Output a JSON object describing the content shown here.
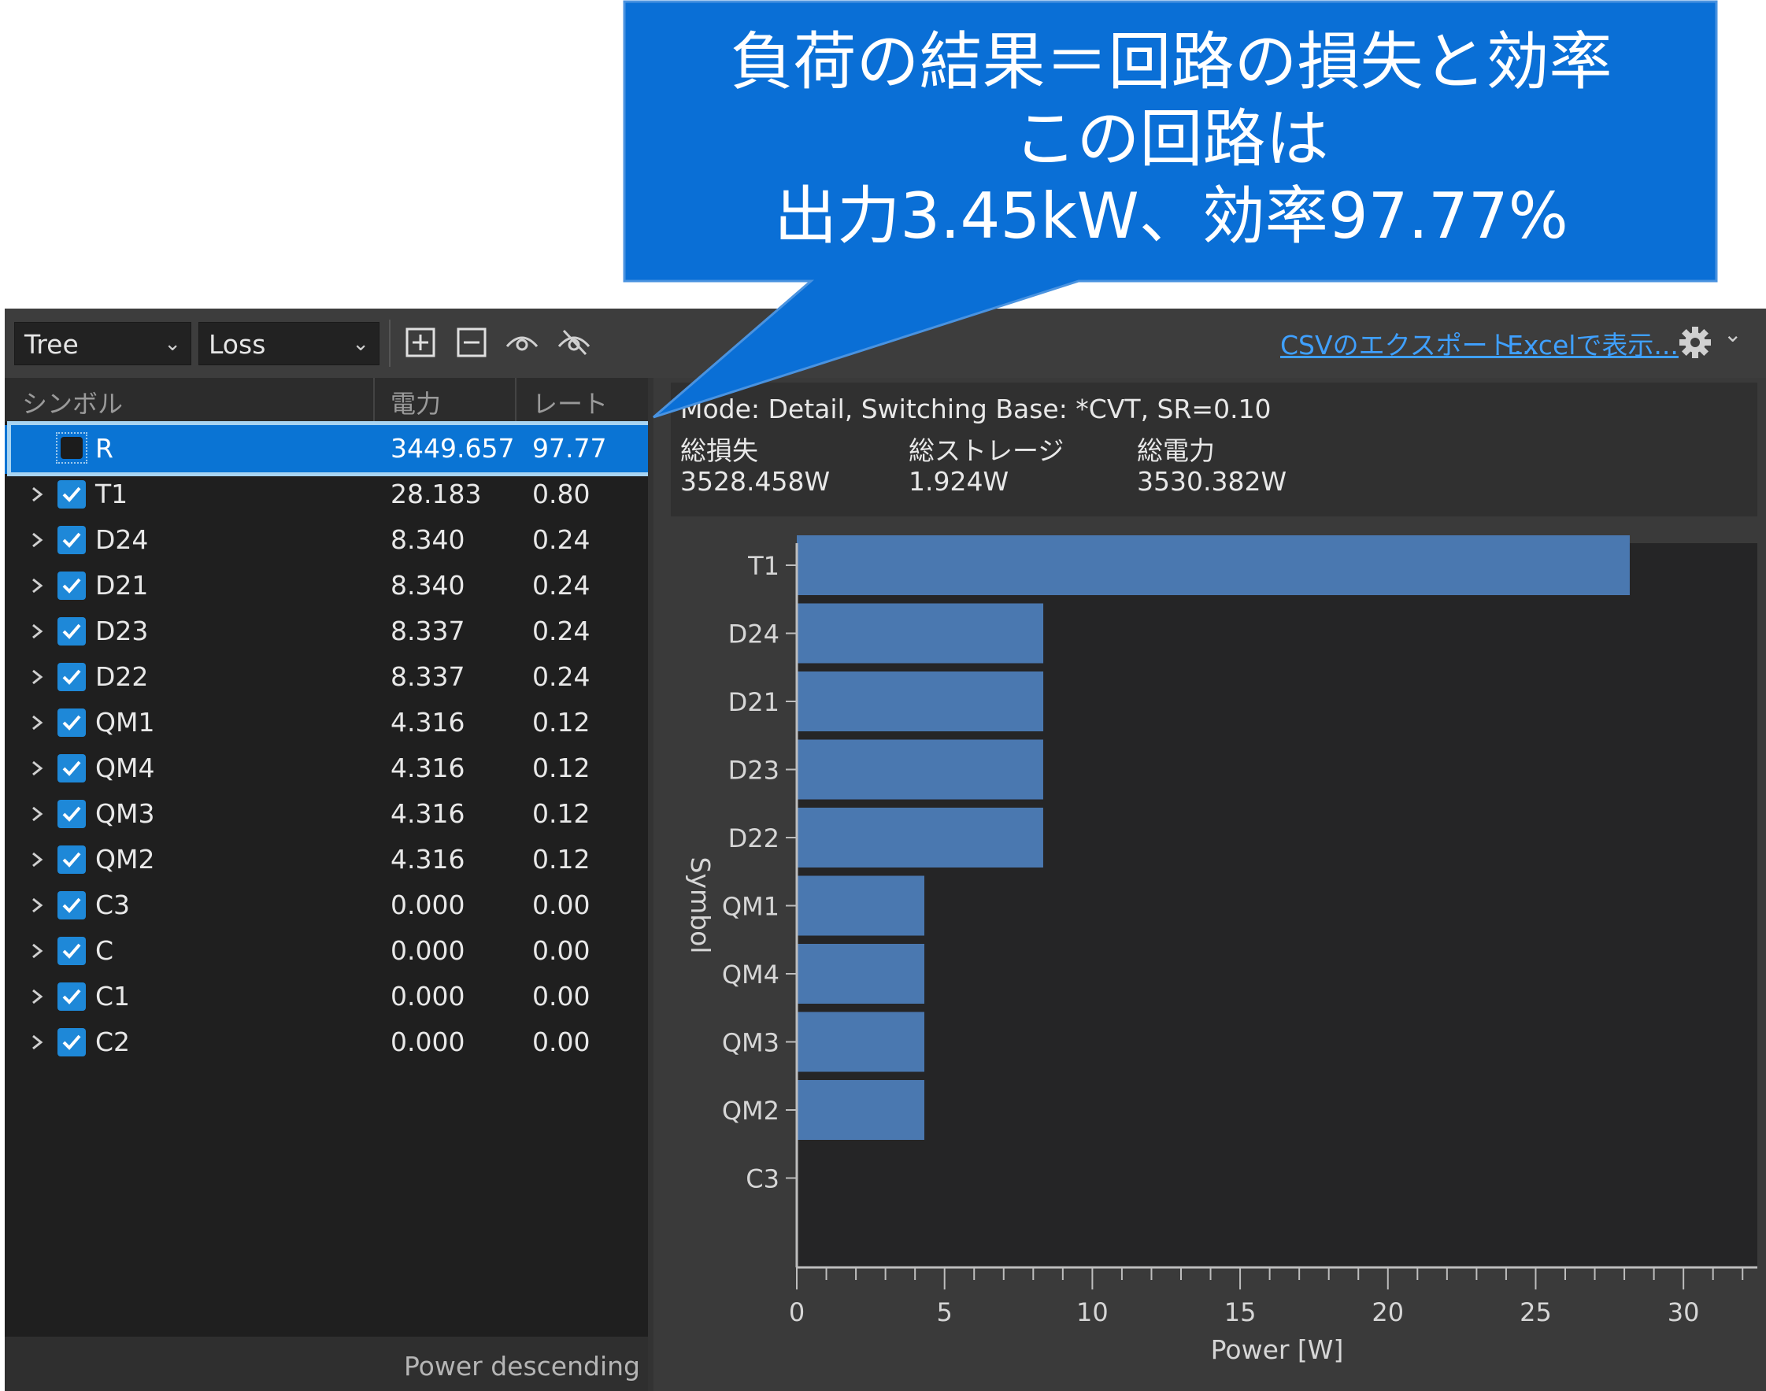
{
  "callout": {
    "line1": "負荷の結果＝回路の損失と効率",
    "line2": "この回路は",
    "line3": "出力3.45kW、効率97.77%"
  },
  "toolbar": {
    "view_combo": "Tree",
    "type_combo": "Loss",
    "icons": [
      "expand-all-icon",
      "collapse-all-icon",
      "show-icon",
      "hide-icon",
      "gear-icon"
    ],
    "csv_link": "CSVのエクスポート...",
    "excel_link": "Excelで表示..."
  },
  "table": {
    "columns": [
      "シンボル",
      "電力",
      "レート[%]"
    ],
    "selected": {
      "symbol": "R",
      "power": "3449.657",
      "rate": "97.77"
    },
    "rows": [
      {
        "symbol": "T1",
        "power": "28.183",
        "rate": "0.80"
      },
      {
        "symbol": "D24",
        "power": "8.340",
        "rate": "0.24"
      },
      {
        "symbol": "D21",
        "power": "8.340",
        "rate": "0.24"
      },
      {
        "symbol": "D23",
        "power": "8.337",
        "rate": "0.24"
      },
      {
        "symbol": "D22",
        "power": "8.337",
        "rate": "0.24"
      },
      {
        "symbol": "QM1",
        "power": "4.316",
        "rate": "0.12"
      },
      {
        "symbol": "QM4",
        "power": "4.316",
        "rate": "0.12"
      },
      {
        "symbol": "QM3",
        "power": "4.316",
        "rate": "0.12"
      },
      {
        "symbol": "QM2",
        "power": "4.316",
        "rate": "0.12"
      },
      {
        "symbol": "C3",
        "power": "0.000",
        "rate": "0.00"
      },
      {
        "symbol": "C",
        "power": "0.000",
        "rate": "0.00"
      },
      {
        "symbol": "C1",
        "power": "0.000",
        "rate": "0.00"
      },
      {
        "symbol": "C2",
        "power": "0.000",
        "rate": "0.00"
      }
    ],
    "status": "Power descending"
  },
  "summary": {
    "mode": "Mode: Detail, Switching Base: *CVT, SR=0.10",
    "loss_label": "総損失",
    "loss_value": "3528.458W",
    "storage_label": "総ストレージ",
    "storage_value": "1.924W",
    "power_label": "総電力",
    "power_value": "3530.382W"
  },
  "chart_data": {
    "type": "bar",
    "orientation": "horizontal",
    "categories": [
      "T1",
      "D24",
      "D21",
      "D23",
      "D22",
      "QM1",
      "QM4",
      "QM3",
      "QM2",
      "C3"
    ],
    "values": [
      28.183,
      8.34,
      8.34,
      8.337,
      8.337,
      4.316,
      4.316,
      4.316,
      4.316,
      0.0
    ],
    "xlabel": "Power [W]",
    "ylabel": "Symbol",
    "xlim": [
      0,
      32.5
    ],
    "xticks": [
      0,
      5,
      10,
      15,
      20,
      25,
      30
    ],
    "bar_color": "#4a78b0",
    "background": "#252526"
  },
  "colors": {
    "callout_fill": "#0a6fd6",
    "selection": "#0a74d4",
    "link": "#3fa0ff",
    "checkbox": "#1e88d8"
  }
}
